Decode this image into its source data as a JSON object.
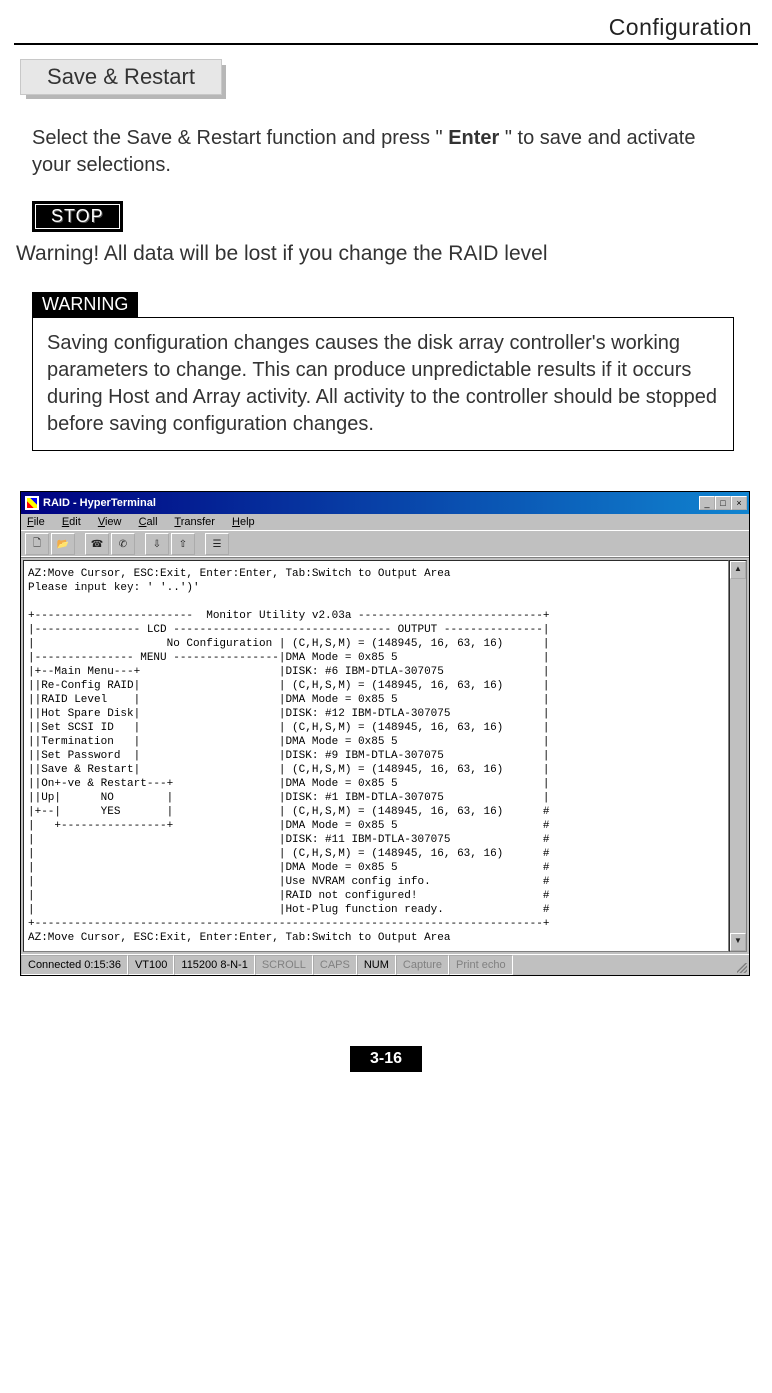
{
  "header": {
    "title": "Configuration"
  },
  "section": {
    "title": "Save & Restart"
  },
  "intro": {
    "pre": "Select the Save & Restart function and press \" ",
    "key": "Enter",
    "post": " \" to save and activate your selections."
  },
  "stop": {
    "label": "STOP"
  },
  "stop_warning": "Warning!  All data will be lost if you change the RAID level",
  "warning": {
    "label": "WARNING"
  },
  "warning_box": "Saving configuration changes causes the disk array controller's working parameters to change. This can produce unpredictable results if it occurs during Host and Array activity. All activity to the controller should be stopped before saving configuration changes.",
  "window": {
    "title": "RAID - HyperTerminal",
    "menu": [
      "File",
      "Edit",
      "View",
      "Call",
      "Transfer",
      "Help"
    ],
    "terminal_text": "AZ:Move Cursor, ESC:Exit, Enter:Enter, Tab:Switch to Output Area\nPlease input key: ' '..')'\n\n+------------------------  Monitor Utility v2.03a ----------------------------+\n|---------------- LCD --------------------------------- OUTPUT ---------------|\n|                    No Configuration | (C,H,S,M) = (148945, 16, 63, 16)      |\n|--------------- MENU ----------------|DMA Mode = 0x85 5                      |\n|+--Main Menu---+                     |DISK: #6 IBM-DTLA-307075               |\n||Re-Config RAID|                     | (C,H,S,M) = (148945, 16, 63, 16)      |\n||RAID Level    |                     |DMA Mode = 0x85 5                      |\n||Hot Spare Disk|                     |DISK: #12 IBM-DTLA-307075              |\n||Set SCSI ID   |                     | (C,H,S,M) = (148945, 16, 63, 16)      |\n||Termination   |                     |DMA Mode = 0x85 5                      |\n||Set Password  |                     |DISK: #9 IBM-DTLA-307075               |\n||Save & Restart|                     | (C,H,S,M) = (148945, 16, 63, 16)      |\n||On+-ve & Restart---+                |DMA Mode = 0x85 5                      |\n||Up|      NO        |                |DISK: #1 IBM-DTLA-307075               |\n|+--|      YES       |                | (C,H,S,M) = (148945, 16, 63, 16)      #\n|   +----------------+                |DMA Mode = 0x85 5                      #\n|                                     |DISK: #11 IBM-DTLA-307075              #\n|                                     | (C,H,S,M) = (148945, 16, 63, 16)      #\n|                                     |DMA Mode = 0x85 5                      #\n|                                     |Use NVRAM config info.                 #\n|                                     |RAID not configured!                   #\n|                                     |Hot-Plug function ready.               #\n+-----------------------------------------------------------------------------+\nAZ:Move Cursor, ESC:Exit, Enter:Enter, Tab:Switch to Output Area",
    "status": {
      "connected": "Connected 0:15:36",
      "emu": "VT100",
      "baud": "115200 8-N-1",
      "scroll": "SCROLL",
      "caps": "CAPS",
      "num": "NUM",
      "capture": "Capture",
      "print": "Print echo"
    }
  },
  "page_number": "3-16"
}
